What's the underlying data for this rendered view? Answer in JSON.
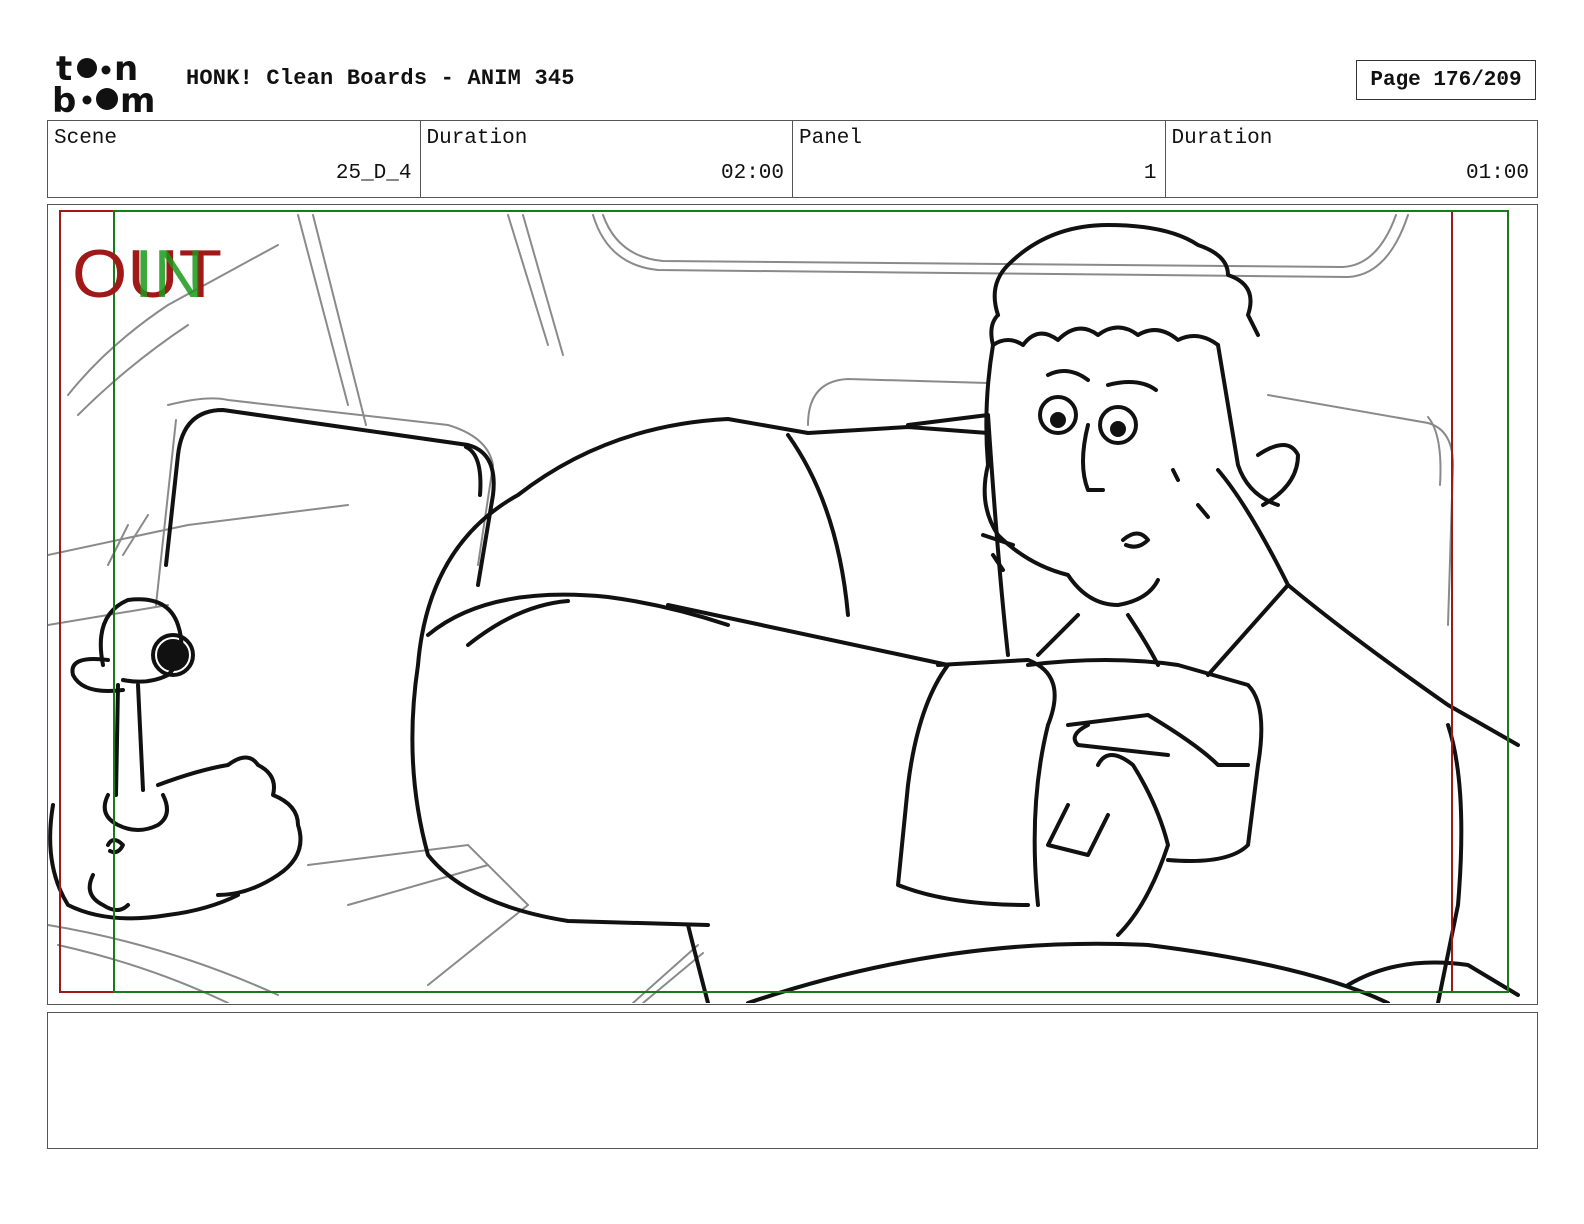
{
  "header": {
    "title": "HONK! Clean Boards - ANIM 345",
    "page": "Page 176/209",
    "logo_text": "toon boom"
  },
  "info": {
    "scene_label": "Scene",
    "scene_value": "25_D_4",
    "scene_duration_label": "Duration",
    "scene_duration_value": "02:00",
    "panel_label": "Panel",
    "panel_value": "1",
    "panel_duration_label": "Duration",
    "panel_duration_value": "01:00"
  },
  "panel": {
    "overlay_out_text": "OUT",
    "overlay_in_text": "IN",
    "colors": {
      "out_frame": "#a01818",
      "in_frame": "#1a7a1a",
      "ink": "#111111",
      "rough": "#8a8a8a"
    }
  },
  "notes": {
    "text": ""
  }
}
